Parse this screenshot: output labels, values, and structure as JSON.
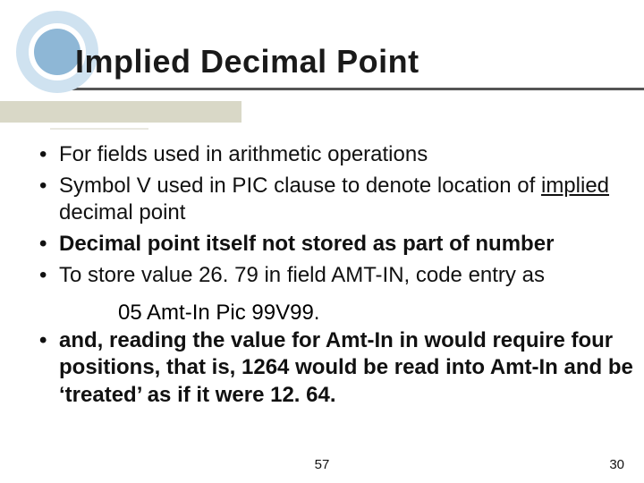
{
  "title": "Implied Decimal Point",
  "bullets": {
    "b1": "For fields used in arithmetic operations",
    "b2_a": "Symbol V used in PIC clause to denote location of ",
    "b2_u": "implied",
    "b2_b": " decimal point",
    "b3": "Decimal point itself not stored as part of number",
    "b4": "To store value 26. 79 in field AMT-IN, code entry as",
    "code": "05  Amt-In  Pic 99V99.",
    "b5": "and, reading the value for Amt-In in would require four positions, that is, 1264 would be read into Amt-In and be ‘treated’ as if it were 12. 64."
  },
  "page_center": "57",
  "page_right": "30"
}
